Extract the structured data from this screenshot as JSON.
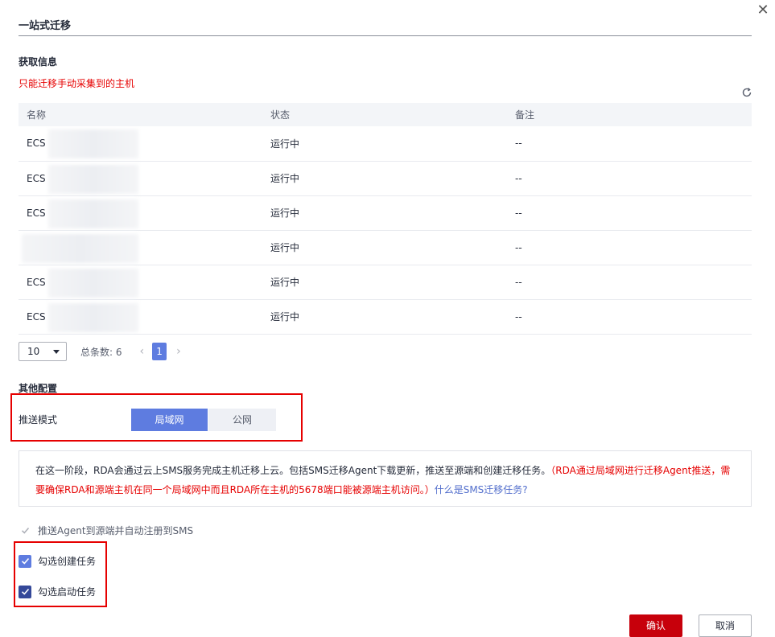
{
  "dialog": {
    "title": "一站式迁移",
    "close_icon": "close-icon"
  },
  "info_section": {
    "title": "获取信息",
    "warning": "只能迁移手动采集到的主机"
  },
  "table": {
    "columns": [
      "名称",
      "状态",
      "备注"
    ],
    "rows": [
      {
        "name": "ECS",
        "status": "运行中",
        "remark": "--"
      },
      {
        "name": "ECS",
        "status": "运行中",
        "remark": "--"
      },
      {
        "name": "ECS",
        "status": "运行中",
        "remark": "--"
      },
      {
        "name": "",
        "status": "运行中",
        "remark": "--"
      },
      {
        "name": "ECS",
        "status": "运行中",
        "remark": "--"
      },
      {
        "name": "ECS",
        "status": "运行中",
        "remark": "--"
      }
    ]
  },
  "pager": {
    "page_size": "10",
    "total_label": "总条数: 6",
    "current_page": "1",
    "prev": "‹",
    "next": "›"
  },
  "other_config": {
    "title": "其他配置",
    "push_mode_label": "推送模式",
    "options": [
      "局域网",
      "公网"
    ],
    "selected": "局域网"
  },
  "info_box": {
    "text": "在这一阶段，RDA会通过云上SMS服务完成主机迁移上云。包括SMS迁移Agent下载更新，推送至源端和创建迁移任务。",
    "red_text": "（RDA通过局域网进行迁移Agent推送，需要确保RDA和源端主机在同一个局域网中而且RDA所在主机的5678端口能被源端主机访问。）",
    "link": "什么是SMS迁移任务?"
  },
  "checkboxes": {
    "push_agent": "推送Agent到源端并自动注册到SMS",
    "create_task": "勾选创建任务",
    "start_task": "勾选启动任务"
  },
  "buttons": {
    "confirm": "确认",
    "cancel": "取消"
  },
  "colors": {
    "primary_red": "#c7000b",
    "accent_blue": "#5e7ce0",
    "dark_blue": "#344899",
    "warning_red": "#e60000"
  }
}
